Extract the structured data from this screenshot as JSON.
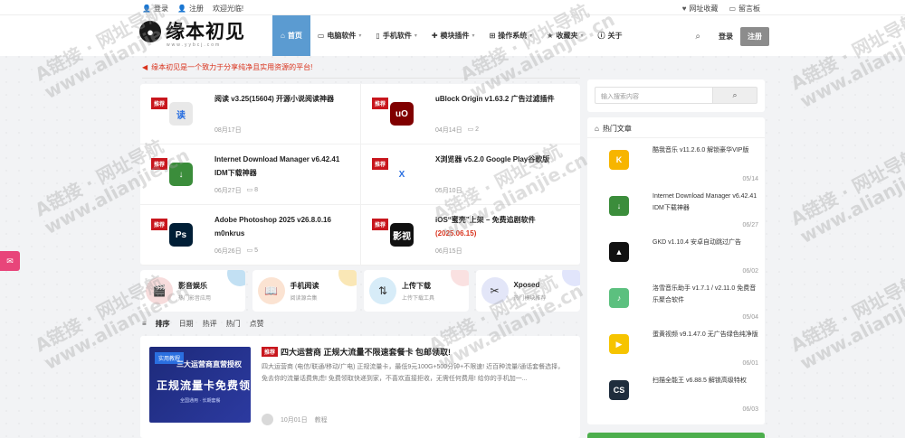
{
  "topbar": {
    "login": "登录",
    "register": "注册",
    "welcome": "欢迎光临!",
    "favorite": "网址收藏",
    "guestbook": "留言板"
  },
  "header": {
    "logo_text": "缘本初见",
    "logo_sub": "www.yybcj.com",
    "nav": [
      {
        "label": "首页",
        "icon": "home-icon",
        "active": true
      },
      {
        "label": "电脑软件",
        "icon": "desktop-icon",
        "dropdown": true
      },
      {
        "label": "手机软件",
        "icon": "mobile-icon",
        "dropdown": true
      },
      {
        "label": "模块插件",
        "icon": "puzzle-icon",
        "dropdown": true
      },
      {
        "label": "操作系统",
        "icon": "windows-icon",
        "dropdown": true
      },
      {
        "label": "收藏夹",
        "icon": "star-icon",
        "dropdown": true
      },
      {
        "label": "关于",
        "icon": "info-icon"
      }
    ],
    "login": "登录",
    "register": "注册"
  },
  "notice": "缘本初见是一个致力于分享纯净且实用资源的平台!",
  "featured": [
    {
      "badge": "推荐",
      "title": "阅读 v3.25(15604) 开源小说阅读神器",
      "date": "08月17日",
      "comments": "",
      "icon": "book-app-icon",
      "color": "#e8e8e8",
      "glyph": "读"
    },
    {
      "badge": "推荐",
      "title": "uBlock Origin v1.63.2 广告过滤插件",
      "date": "04月14日",
      "comments": "2",
      "icon": "ublock-icon",
      "color": "#800000",
      "glyph": "uO"
    },
    {
      "badge": "推荐",
      "title": "Internet Download Manager v6.42.41 IDM下载神器",
      "date": "06月27日",
      "comments": "8",
      "icon": "idm-icon",
      "color": "#3b8d3b",
      "glyph": "↓"
    },
    {
      "badge": "推荐",
      "title": "X浏览器 v5.2.0 Google Play谷歌版",
      "date": "05月10日",
      "comments": "",
      "icon": "x-browser-icon",
      "color": "#ffffff",
      "glyph": "X"
    },
    {
      "badge": "推荐",
      "title": "Adobe Photoshop 2025 v26.8.0.16 m0nkrus",
      "date": "06月26日",
      "comments": "5",
      "icon": "photoshop-icon",
      "color": "#001e36",
      "glyph": "Ps"
    },
    {
      "badge": "推荐",
      "title_main": "iOS“蜜壳”上架 – 免费追剧软件 ",
      "title_red": "(2025.06.15)",
      "date": "06月15日",
      "comments": "",
      "icon": "mike-video-icon",
      "color": "#111111",
      "glyph": "影视"
    }
  ],
  "cards": [
    {
      "title": "影音娱乐",
      "sub": "热门影音应用",
      "icon": "film-icon",
      "bg": "#f7dcdc",
      "blob": "#8fc6ea"
    },
    {
      "title": "手机阅读",
      "sub": "阅读源合集",
      "icon": "reading-icon",
      "bg": "#fbe3d2",
      "blob": "#f5d37a"
    },
    {
      "title": "上传下载",
      "sub": "上传下载工具",
      "icon": "download-icon",
      "bg": "#d7ecf8",
      "blob": "#f5c9c9"
    },
    {
      "title": "Xposed",
      "sub": "热门模块推荐",
      "icon": "xposed-icon",
      "bg": "#e3e6f8",
      "blob": "#c9d0f7"
    }
  ],
  "sort_tabs": [
    "排序",
    "日期",
    "热评",
    "热门",
    "点赞"
  ],
  "article": {
    "img_tag": "实用教程",
    "img_line1": "三大运营商直营授权",
    "img_line2": "正规流量卡免费领",
    "img_line3": "全国通用 · 长期套餐",
    "badge": "推荐",
    "title": "四大运营商 正规大流量不限速套餐卡 包邮领取!",
    "desc": "四大运营商 (电信/联通/移动/广电) 正规流量卡，最低9元100G+500分钟+不限速! 近百种流量/通话套餐选择，免去你的流量话费焦虑! 免费领取快递到家，不喜欢直接拒收，无需任何费用! 给你的手机加一...",
    "date": "10月01日",
    "category": "教程"
  },
  "sidebar": {
    "search_placeholder": "输入搜索内容",
    "hot_title": "热门文章",
    "hot": [
      {
        "title": "酷我音乐 v11.2.6.0 解锁豪华VIP版",
        "date": "05/14",
        "icon": "kuwo-icon",
        "color": "#f7b500",
        "glyph": "K"
      },
      {
        "title": "Internet Download Manager v6.42.41 IDM下载神器",
        "date": "06/27",
        "icon": "idm-icon",
        "color": "#3b8d3b",
        "glyph": "↓"
      },
      {
        "title": "GKD v1.10.4 安卓自动跳过广告",
        "date": "06/02",
        "icon": "gkd-icon",
        "color": "#111111",
        "glyph": "▲"
      },
      {
        "title": "洛雪音乐助手 v1.7.1 / v2.11.0 免费音乐聚合软件",
        "date": "05/04",
        "icon": "lx-music-icon",
        "color": "#5cc07f",
        "glyph": "♪"
      },
      {
        "title": "蛋黄视频 v9.1.47.0 无广告绿色纯净版",
        "date": "06/01",
        "icon": "egg-video-icon",
        "color": "#f6c400",
        "glyph": "▶"
      },
      {
        "title": "扫描全能王 v6.88.5 解锁高级特权",
        "date": "06/03",
        "icon": "camscanner-icon",
        "color": "#1f2d3d",
        "glyph": "CS"
      }
    ]
  },
  "watermark": [
    "A链接 · 网址导航",
    "www.alianjie.cn"
  ]
}
